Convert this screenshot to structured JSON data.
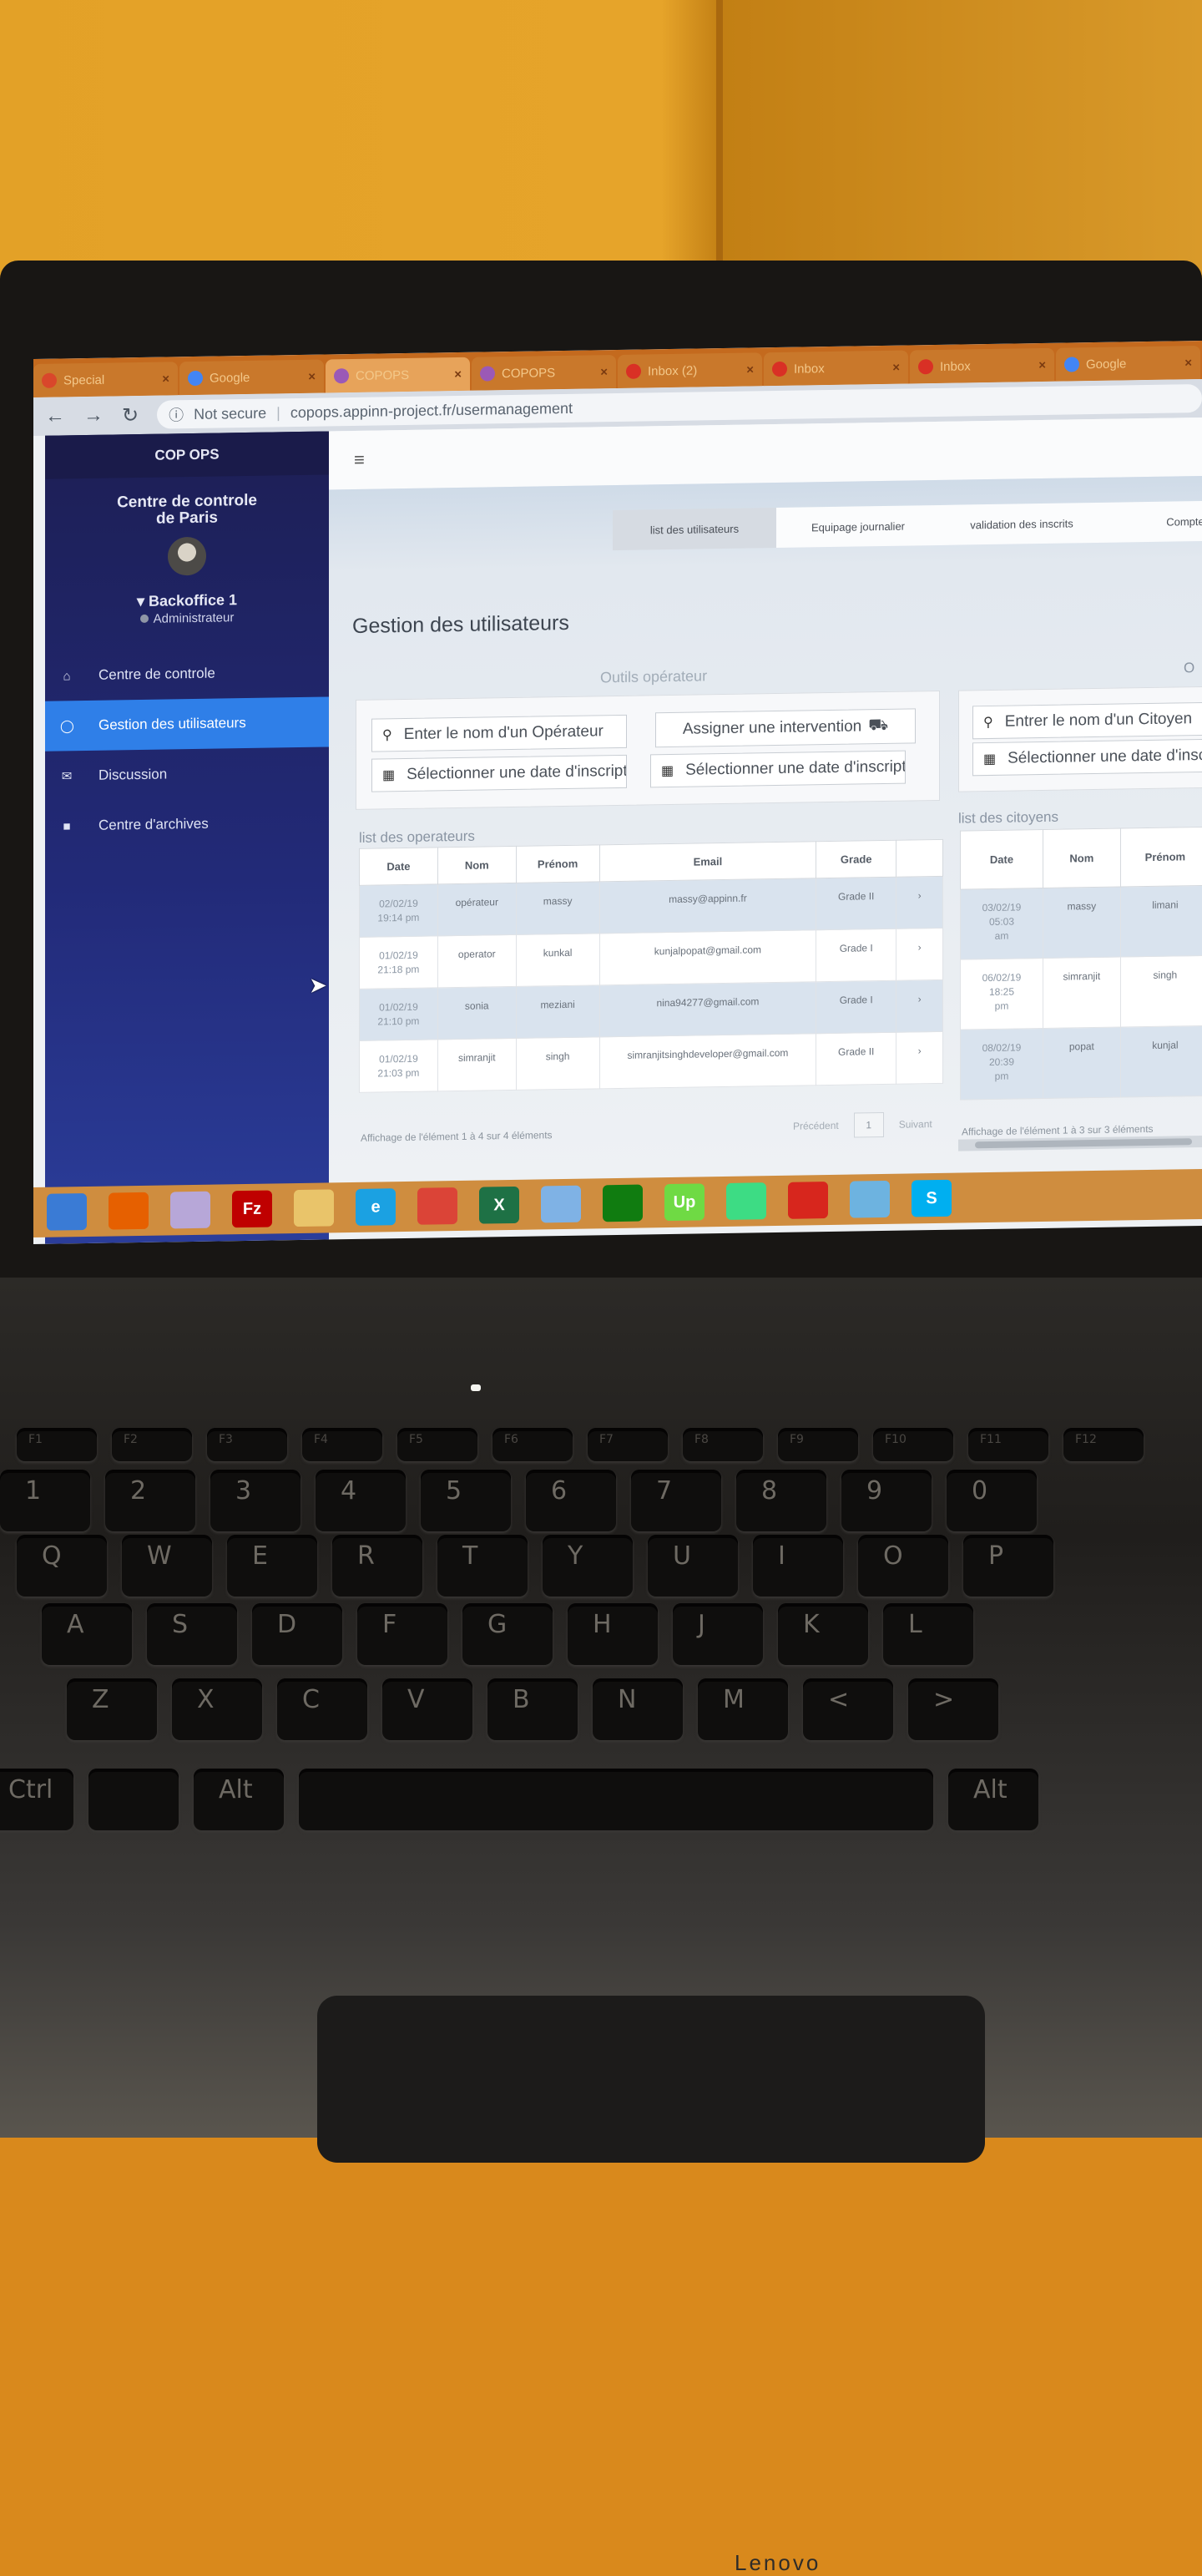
{
  "browser": {
    "tabs": [
      {
        "label": "Special",
        "color": "#d9472b"
      },
      {
        "label": "Google",
        "color": "#4285f4"
      },
      {
        "label": "COPOPS",
        "color": "#9b59b6"
      },
      {
        "label": "COPOPS",
        "color": "#9b59b6"
      },
      {
        "label": "Inbox (2)",
        "color": "#d93025"
      },
      {
        "label": "Inbox",
        "color": "#d93025"
      },
      {
        "label": "Inbox",
        "color": "#d93025"
      },
      {
        "label": "Google",
        "color": "#4285f4"
      }
    ],
    "security": "Not secure",
    "url": "copops.appinn-project.fr/usermanagement"
  },
  "sidebar": {
    "brand": "COP OPS",
    "center_line1": "Centre de controle",
    "center_line2": "de Paris",
    "user": "Backoffice 1",
    "role": "Administrateur",
    "items": [
      {
        "label": "Centre de controle",
        "icon": "home-icon"
      },
      {
        "label": "Gestion des utilisateurs",
        "icon": "user-icon"
      },
      {
        "label": "Discussion",
        "icon": "chat-icon"
      },
      {
        "label": "Centre d'archives",
        "icon": "archive-icon"
      }
    ]
  },
  "tabs": [
    "list des utilisateurs",
    "Equipage journalier",
    "validation des inscrits",
    "Compte"
  ],
  "page_title": "Gestion des utilisateurs",
  "operator_tools": {
    "label": "Outils opérateur",
    "search_placeholder": "Enter le nom d'un Opérateur",
    "date_placeholder": "Sélectionner une date d'inscription",
    "assign_label": "Assigner une intervention",
    "date_placeholder_2": "Sélectionner une date d'inscription"
  },
  "citizen_tools": {
    "label": "O",
    "search_placeholder": "Entrer le nom d'un Citoyen",
    "date_placeholder": "Sélectionner une date d'inscription"
  },
  "operators": {
    "title": "list des operateurs",
    "columns": [
      "Date",
      "Nom",
      "Prénom",
      "Email",
      "Grade"
    ],
    "rows": [
      {
        "date": "02/02/19",
        "time": "19:14 pm",
        "nom": "opérateur",
        "prenom": "massy",
        "email": "massy@appinn.fr",
        "grade": "Grade II"
      },
      {
        "date": "01/02/19",
        "time": "21:18 pm",
        "nom": "operator",
        "prenom": "kunkal",
        "email": "kunjalpopat@gmail.com",
        "grade": "Grade I"
      },
      {
        "date": "01/02/19",
        "time": "21:10 pm",
        "nom": "sonia",
        "prenom": "meziani",
        "email": "nina94277@gmail.com",
        "grade": "Grade I"
      },
      {
        "date": "01/02/19",
        "time": "21:03 pm",
        "nom": "simranjit",
        "prenom": "singh",
        "email": "simranjitsinghdeveloper@gmail.com",
        "grade": "Grade II"
      }
    ],
    "info": "Affichage de l'élément 1 à 4 sur 4 éléments",
    "prev": "Précédent",
    "page": "1",
    "next": "Suivant"
  },
  "citizens": {
    "title": "list des citoyens",
    "columns": [
      "Date",
      "Nom",
      "Prénom"
    ],
    "rows": [
      {
        "date": "03/02/19",
        "time": "05:03",
        "ampm": "am",
        "nom": "massy",
        "prenom": "limani"
      },
      {
        "date": "06/02/19",
        "time": "18:25",
        "ampm": "pm",
        "nom": "simranjit",
        "prenom": "singh"
      },
      {
        "date": "08/02/19",
        "time": "20:39",
        "ampm": "pm",
        "nom": "popat",
        "prenom": "kunjal"
      }
    ],
    "info": "Affichage de l'élément 1 à 3 sur 3 éléments"
  },
  "taskbar": [
    {
      "label": "",
      "name": "windows-start-icon",
      "color": "#3a7bd5"
    },
    {
      "label": "",
      "name": "firefox-icon",
      "color": "#e66000"
    },
    {
      "label": "",
      "name": "app-icon",
      "color": "#b7a7d8"
    },
    {
      "label": "Fz",
      "name": "filezilla-icon",
      "color": "#bf0000"
    },
    {
      "label": "",
      "name": "file-explorer-icon",
      "color": "#e9c46a"
    },
    {
      "label": "e",
      "name": "internet-explorer-icon",
      "color": "#1ba1e2"
    },
    {
      "label": "",
      "name": "chrome-icon",
      "color": "#db4437"
    },
    {
      "label": "X",
      "name": "excel-icon",
      "color": "#1e7145"
    },
    {
      "label": "",
      "name": "paint-icon",
      "color": "#7fb2e5"
    },
    {
      "label": "",
      "name": "store-icon",
      "color": "#107c10"
    },
    {
      "label": "Up",
      "name": "upwork-icon",
      "color": "#6fda44"
    },
    {
      "label": "",
      "name": "android-studio-icon",
      "color": "#3ddc84"
    },
    {
      "label": "",
      "name": "acrobat-icon",
      "color": "#d7261d"
    },
    {
      "label": "",
      "name": "notes-icon",
      "color": "#6db3e0"
    },
    {
      "label": "S",
      "name": "skype-icon",
      "color": "#00aff0"
    }
  ],
  "keyboard": {
    "brand": "Lenovo",
    "fn_row": [
      "F1",
      "F2",
      "F3",
      "F4",
      "F5",
      "F6",
      "F7",
      "F8",
      "F9",
      "F10",
      "F11",
      "F12"
    ],
    "num_row": [
      "1",
      "2",
      "3",
      "4",
      "5",
      "6",
      "7",
      "8",
      "9",
      "0"
    ],
    "top_row": [
      "Q",
      "W",
      "E",
      "R",
      "T",
      "Y",
      "U",
      "I",
      "O",
      "P"
    ],
    "home_row": [
      "A",
      "S",
      "D",
      "F",
      "G",
      "H",
      "J",
      "K",
      "L"
    ],
    "bottom_row": [
      "Z",
      "X",
      "C",
      "V",
      "B",
      "N",
      "M",
      "<",
      ">"
    ],
    "space_row": [
      "Ctrl",
      "",
      "Alt",
      "",
      "Alt"
    ]
  }
}
